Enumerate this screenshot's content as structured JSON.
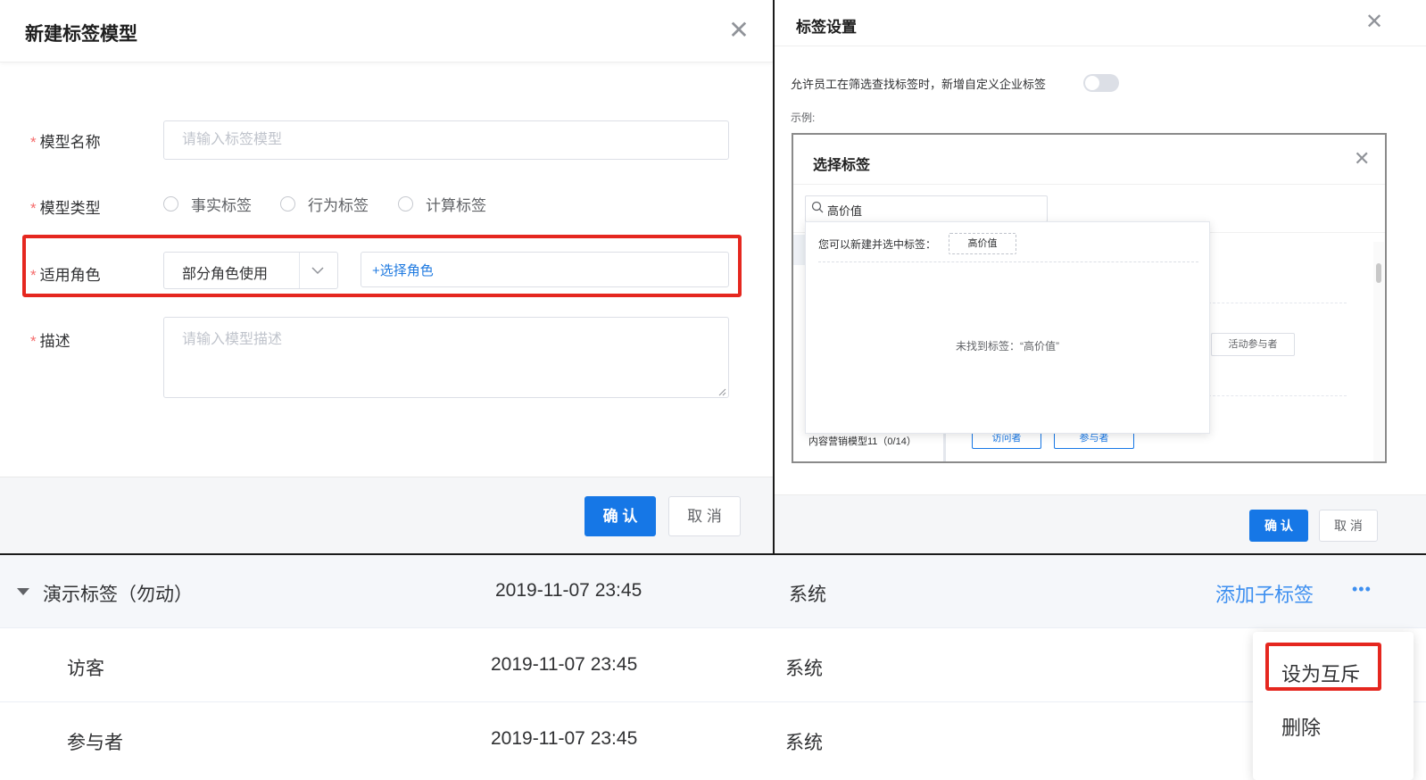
{
  "left_dialog": {
    "title": "新建标签模型",
    "fields": {
      "name_label": "模型名称",
      "name_placeholder": "请输入标签模型",
      "type_label": "模型类型",
      "type_options": [
        "事实标签",
        "行为标签",
        "计算标签"
      ],
      "role_label": "适用角色",
      "role_select_value": "部分角色使用",
      "role_add": "+选择角色",
      "desc_label": "描述",
      "desc_placeholder": "请输入模型描述",
      "required_mark": "*"
    },
    "confirm": "确 认",
    "cancel": "取 消"
  },
  "right_dialog": {
    "title": "标签设置",
    "allow_text": "允许员工在筛选查找标签时，新增自定义企业标签",
    "example_label": "示例:",
    "inner": {
      "title": "选择标签",
      "search_value": "高价值",
      "create_hint": "您可以新建并选中标签：",
      "create_chip": "高价值",
      "empty_text": "未找到标签：“高价值”",
      "bg_tag_1": "活动参与者",
      "bg_model": "内容营销模型11（0/14）",
      "bg_tag_visitor": "访问者",
      "bg_tag_participant": "参与者"
    },
    "confirm": "确 认",
    "cancel": "取 消"
  },
  "table": {
    "parent": {
      "name": "演示标签（勿动）",
      "time": "2019-11-07 23:45",
      "creator": "系统",
      "add_child": "添加子标签",
      "more": "•••"
    },
    "children": [
      {
        "name": "访客",
        "time": "2019-11-07 23:45",
        "creator": "系统"
      },
      {
        "name": "参与者",
        "time": "2019-11-07 23:45",
        "creator": "系统"
      }
    ],
    "menu": {
      "set_mutex": "设为互斥",
      "delete": "删除"
    }
  },
  "colors": {
    "primary": "#1677e6",
    "highlight_red": "#e5271f",
    "link": "#3d8ff0"
  }
}
